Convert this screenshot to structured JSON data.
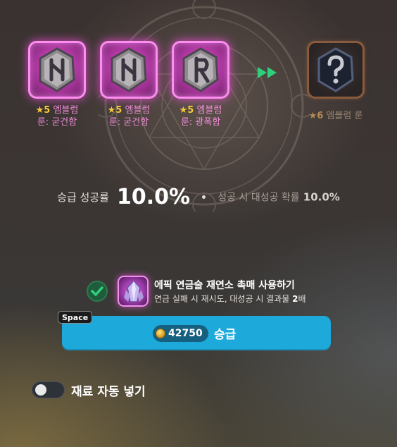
{
  "materials": [
    {
      "grade": "5",
      "name_line1": "엠블럼",
      "name_line2": "룬: 굳건함",
      "icon": "rune-n-icon"
    },
    {
      "grade": "5",
      "name_line1": "엠블럼",
      "name_line2": "룬: 굳건함",
      "icon": "rune-n-icon"
    },
    {
      "grade": "5",
      "name_line1": "엠블럼",
      "name_line2": "룬: 광폭함",
      "icon": "rune-r-icon"
    }
  ],
  "result": {
    "grade": "6",
    "name": "엠블럼 룬",
    "icon": "question-mark-icon"
  },
  "star_symbol": "★",
  "rate": {
    "label": "승급 성공률",
    "value": "10.0%",
    "bonus_label": "성공 시 대성공 확률",
    "bonus_value": "10.0%"
  },
  "catalyst": {
    "checked": true,
    "title": "에픽 연금술 재연소 촉매 사용하기",
    "desc_prefix": "연금 실패 시 재시도, 대성공 시 결과물 ",
    "desc_bold": "2",
    "desc_suffix": "배"
  },
  "upgrade": {
    "hotkey": "Space",
    "cost": "42750",
    "label": "승급"
  },
  "auto_fill": {
    "enabled": false,
    "label": "재료 자동 넣기"
  },
  "colors": {
    "button": "#1ea9db",
    "rune_glow": "#ff8cf0",
    "arrow": "#2fd07a",
    "check": "#2fd07a"
  }
}
